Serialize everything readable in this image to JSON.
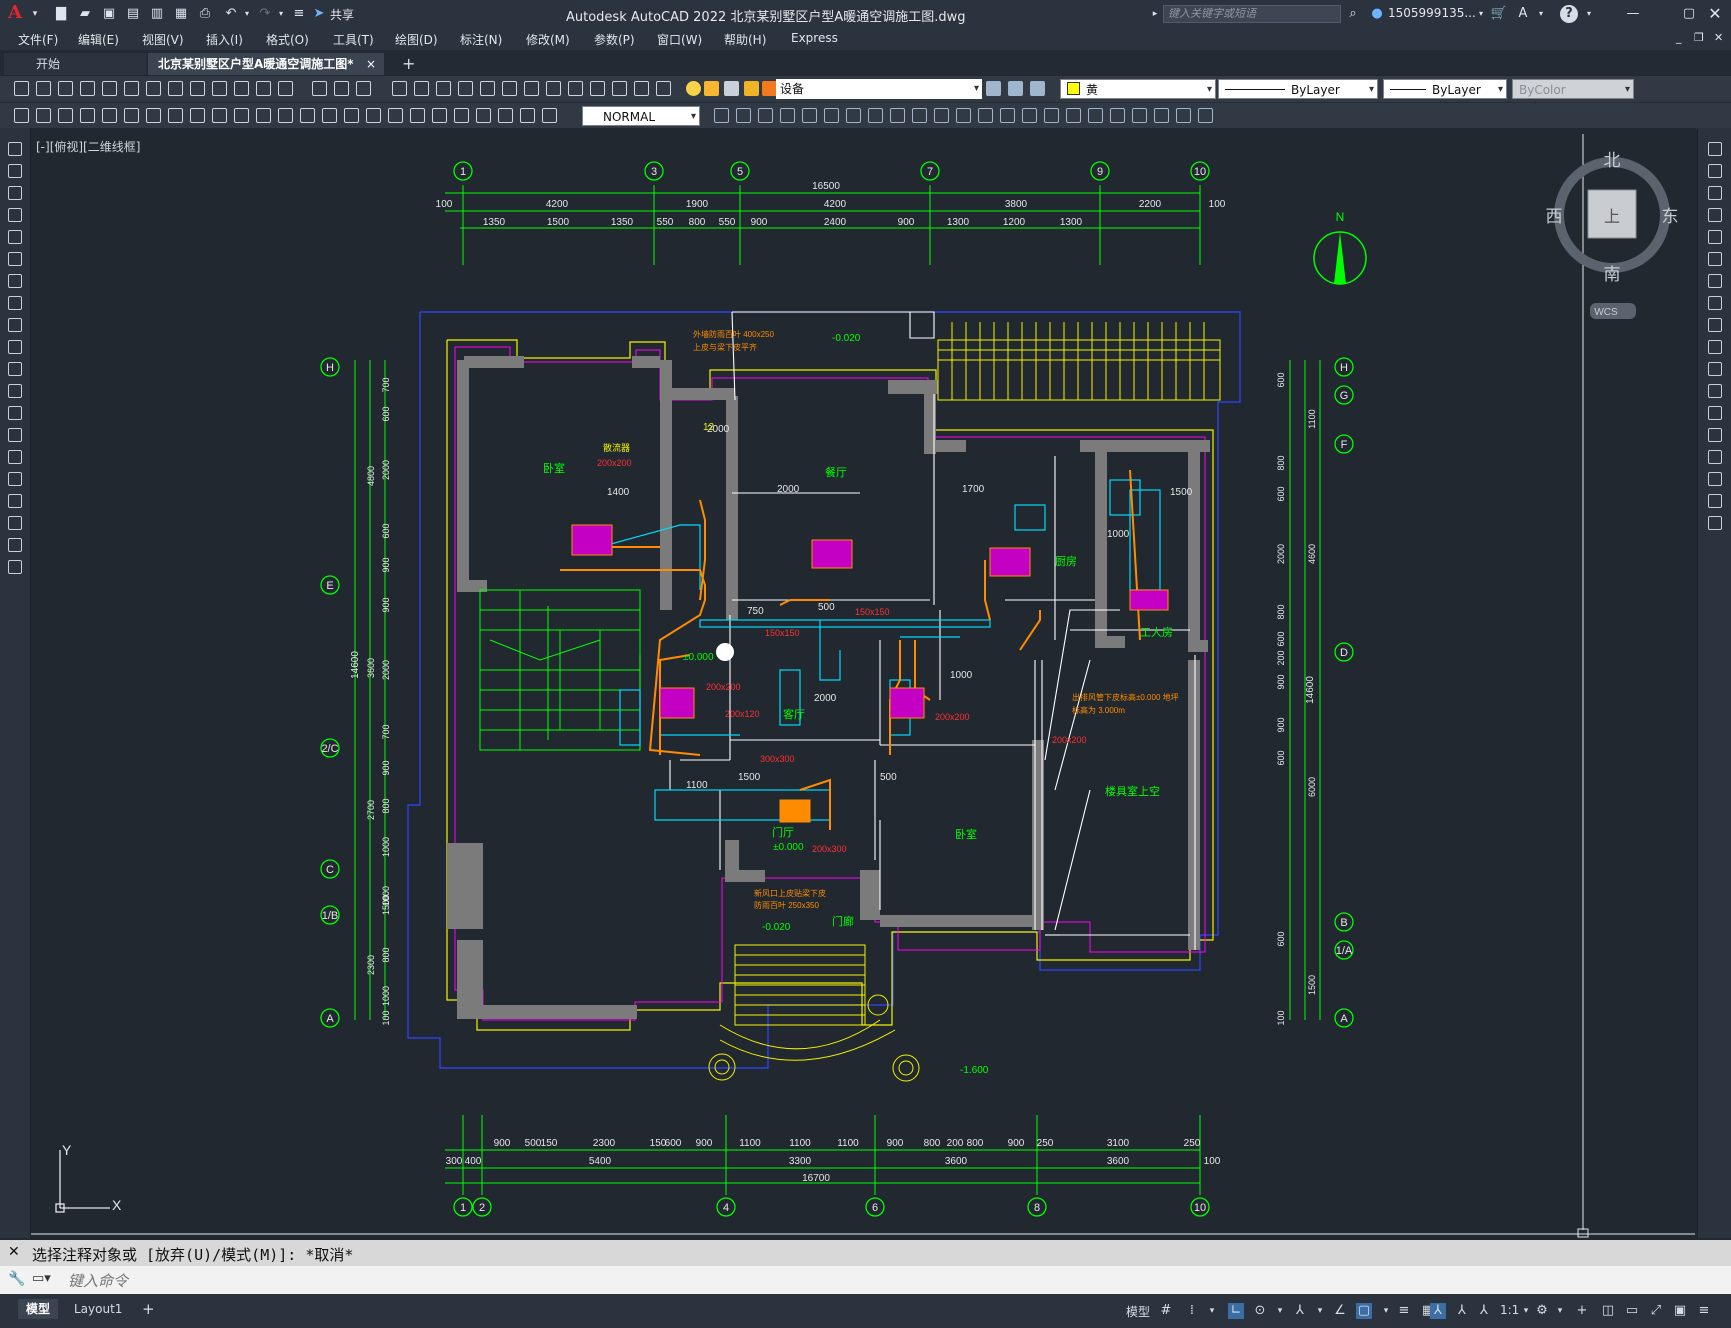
{
  "titlebar": {
    "app_logo": "A",
    "share_label": "共享",
    "window_title": "Autodesk AutoCAD 2022    北京某别墅区户型A暖通空调施工图.dwg",
    "search_placeholder": "键入关键字或短语",
    "user_label": "1505999135...",
    "help_label": "?"
  },
  "menu": {
    "items": [
      "文件(F)",
      "编辑(E)",
      "视图(V)",
      "插入(I)",
      "格式(O)",
      "工具(T)",
      "绘图(D)",
      "标注(N)",
      "修改(M)",
      "参数(P)",
      "窗口(W)",
      "帮助(H)",
      "Express"
    ]
  },
  "tabs": {
    "start": "开始",
    "active": "北京某别墅区户型A暖通空调施工图*",
    "close": "×",
    "add": "+"
  },
  "toolbar": {
    "layer_value": "设备",
    "color_value": "黄",
    "linetype_value": "ByLayer",
    "lineweight_value": "ByLayer",
    "plotstyle_value": "ByColor",
    "style_value": "NORMAL"
  },
  "viewport": {
    "label": "[-][俯视][二维线框]"
  },
  "viewcube": {
    "north": "北",
    "south": "南",
    "east": "东",
    "west": "西",
    "top": "上",
    "wcs": "WCS"
  },
  "drawing": {
    "north_label": "N",
    "top_total": "16500",
    "top_dims_1": [
      "100",
      "4200",
      "1900",
      "4200",
      "3800",
      "2200",
      "100"
    ],
    "top_dims_2": [
      "1350",
      "1500",
      "1350",
      "550",
      "800",
      "550",
      "900",
      "2400",
      "900",
      "1300",
      "1200",
      "1300"
    ],
    "top_axes": [
      "1",
      "3",
      "5",
      "7",
      "9",
      "10"
    ],
    "bottom_total": "16700",
    "bottom_dims_1": [
      "900",
      "500",
      "150",
      "2300",
      "150",
      "600",
      "900",
      "1100",
      "1100",
      "1100",
      "900",
      "800",
      "200",
      "800",
      "900",
      "250",
      "3100",
      "250"
    ],
    "bottom_dims_2": [
      "300",
      "400",
      "5400",
      "3300",
      "3600",
      "3600",
      "100"
    ],
    "bottom_axes": [
      "1",
      "2",
      "4",
      "6",
      "8",
      "10"
    ],
    "left_axes": [
      "H",
      "E",
      "2/C",
      "C",
      "1/B",
      "A"
    ],
    "left_total": "14600",
    "left_dims_1": [
      "4800",
      "3600",
      "2700",
      "2300"
    ],
    "left_dims_2": [
      "700",
      "600",
      "2000",
      "600",
      "900",
      "900",
      "2000",
      "700",
      "900",
      "800",
      "1000",
      "1000",
      "1500",
      "800",
      "1000",
      "100"
    ],
    "right_axes": [
      "H",
      "G",
      "F",
      "D",
      "B",
      "1/A",
      "A"
    ],
    "right_total": "14600",
    "right_dims_1": [
      "1100",
      "4600",
      "6000",
      "1500"
    ],
    "right_dims_2": [
      "600",
      "800",
      "600",
      "2000",
      "800",
      "600",
      "200",
      "900",
      "900",
      "600",
      "600",
      "100"
    ],
    "rooms": [
      "卧室",
      "餐厅",
      "厨房",
      "工人房",
      "卧室",
      "门厅",
      "门廊",
      "楼具室上空",
      "客厅"
    ],
    "labels_red": [
      "散流器",
      "200x200",
      "150x150",
      "150x150",
      "200x200",
      "200x120",
      "300x300",
      "200x300",
      "200x200",
      "200x200"
    ],
    "labels_white": [
      "1400",
      "2000",
      "1700",
      "1000",
      "1500",
      "500",
      "750",
      "2000",
      "1500",
      "1100",
      "500",
      "1000",
      "2000",
      "12"
    ],
    "levels": [
      "-0.020",
      "±0.000",
      "±0.000",
      "-0.020",
      "-1.600",
      "±0.000"
    ],
    "notes": [
      "外墙防雨百叶 400x250",
      "上皮与梁下皮平齐",
      "新风口上皮贴梁下皮",
      "防雨百叶 250x350",
      "出排风管下皮标高±0.000 地坪",
      "标高为 3.000m"
    ]
  },
  "command": {
    "history": "选择注释对象或 [放弃(U)/模式(M)]: *取消*",
    "placeholder": "键入命令"
  },
  "status": {
    "model_tab": "模型",
    "layout_tab": "Layout1",
    "add_tab": "+",
    "model_label": "模型",
    "scale_label": "1:1"
  }
}
